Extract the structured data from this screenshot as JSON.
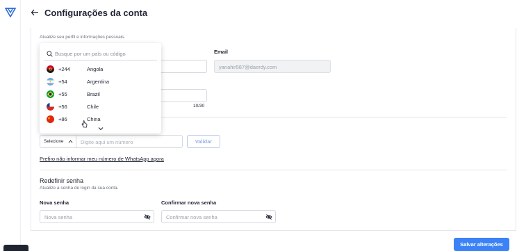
{
  "header": {
    "title": "Configurações da conta"
  },
  "profile": {
    "subtitle": "Atualize seu perfil e informações pessoais.",
    "email_label": "Email",
    "email_value": "yanahir587@daerdy.com",
    "counter": "10/30"
  },
  "phone": {
    "select_label": "Selecione",
    "input_placeholder": "Digite aqui um número",
    "validate_label": "Validar",
    "skip_link": "Prefiro não informar meu número de WhatsApp agora"
  },
  "dropdown": {
    "search_placeholder": "Busque por um país ou código",
    "items": [
      {
        "code": "+244",
        "name": "Angola",
        "flag": "angola-flag-icon"
      },
      {
        "code": "+54",
        "name": "Argentina",
        "flag": "argentina-flag-icon"
      },
      {
        "code": "+55",
        "name": "Brazil",
        "flag": "brazil-flag-icon"
      },
      {
        "code": "+56",
        "name": "Chile",
        "flag": "chile-flag-icon"
      },
      {
        "code": "+86",
        "name": "China",
        "flag": "china-flag-icon"
      }
    ]
  },
  "password": {
    "title": "Redefinir senha",
    "subtitle": "Atualize a senha de login da sua conta.",
    "new_label": "Nova senha",
    "new_placeholder": "Nova senha",
    "confirm_label": "Confirmar nova senha",
    "confirm_placeholder": "Confirmar nova senha"
  },
  "footer": {
    "save_label": "Salvar alterações"
  },
  "colors": {
    "primary": "#3b82f6",
    "text": "#1f2433",
    "muted": "#6b7280",
    "border": "#d5d8de"
  }
}
